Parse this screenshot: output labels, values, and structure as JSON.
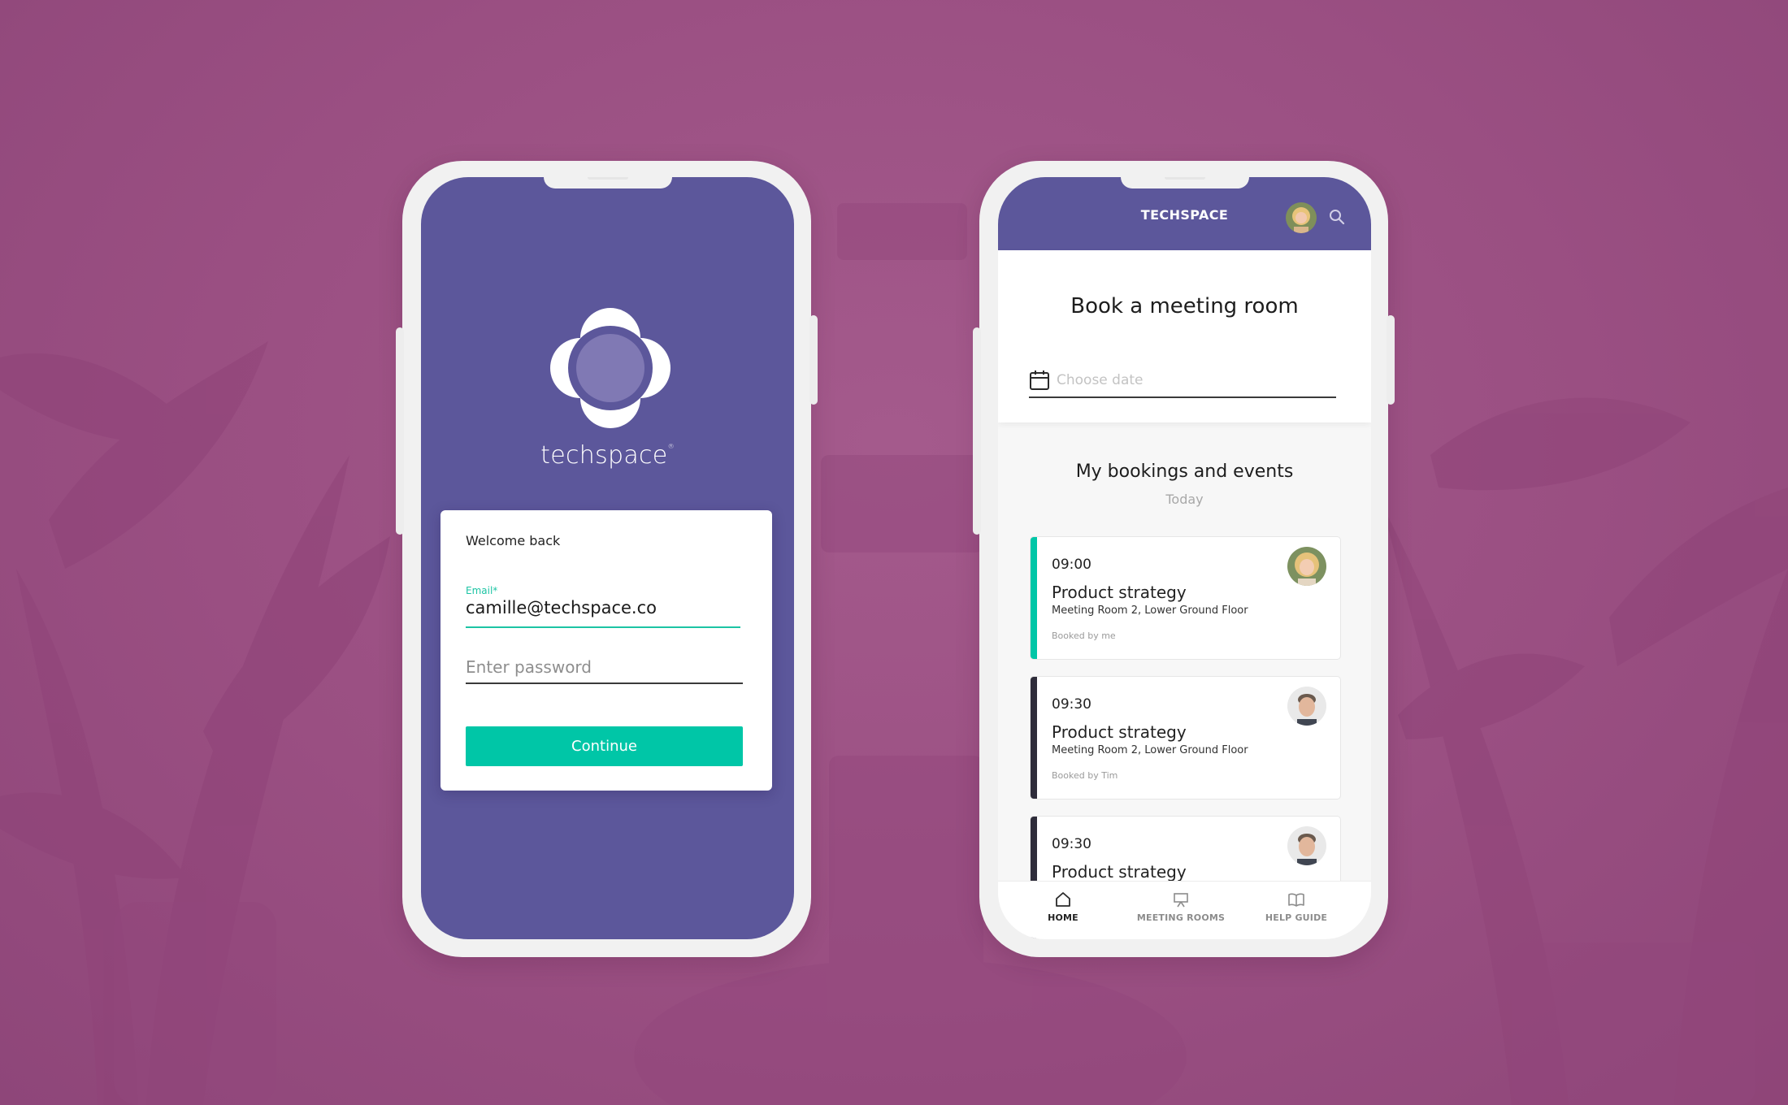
{
  "colors": {
    "brand_purple": "#5c579b",
    "accent_teal": "#00c6a7",
    "background": "#9b4f83",
    "dark_accent": "#2e2c3a"
  },
  "login": {
    "brand_name": "techspace",
    "trademark": "®",
    "card": {
      "heading": "Welcome back",
      "email_label": "Email*",
      "email_value": "camille@techspace.co",
      "password_placeholder": "Enter password",
      "continue_label": "Continue"
    }
  },
  "app": {
    "header": {
      "title": "TECHSPACE",
      "avatar_icon": "user-avatar",
      "search_icon": "search-icon"
    },
    "booking": {
      "title": "Book a meeting room",
      "date_placeholder": "Choose date",
      "calendar_icon": "calendar-icon"
    },
    "bookings_section": {
      "title": "My bookings and events",
      "subtitle": "Today",
      "items": [
        {
          "time": "09:00",
          "name": "Product strategy",
          "location": "Meeting Room 2, Lower Ground Floor",
          "booked_by": "Booked by me",
          "accent": "#00c6a7",
          "avatar": "woman-avatar"
        },
        {
          "time": "09:30",
          "name": "Product strategy",
          "location": "Meeting Room 2, Lower Ground Floor",
          "booked_by": "Booked by Tim",
          "accent": "#2e2c3a",
          "avatar": "man-avatar"
        },
        {
          "time": "09:30",
          "name": "Product strategy",
          "location": "",
          "booked_by": "",
          "accent": "#2e2c3a",
          "avatar": "man-avatar"
        }
      ]
    },
    "tabbar": [
      {
        "label": "HOME",
        "icon": "home-icon",
        "active": true
      },
      {
        "label": "MEETING ROOMS",
        "icon": "presentation-icon",
        "active": false
      },
      {
        "label": "HELP GUIDE",
        "icon": "book-icon",
        "active": false
      }
    ]
  }
}
